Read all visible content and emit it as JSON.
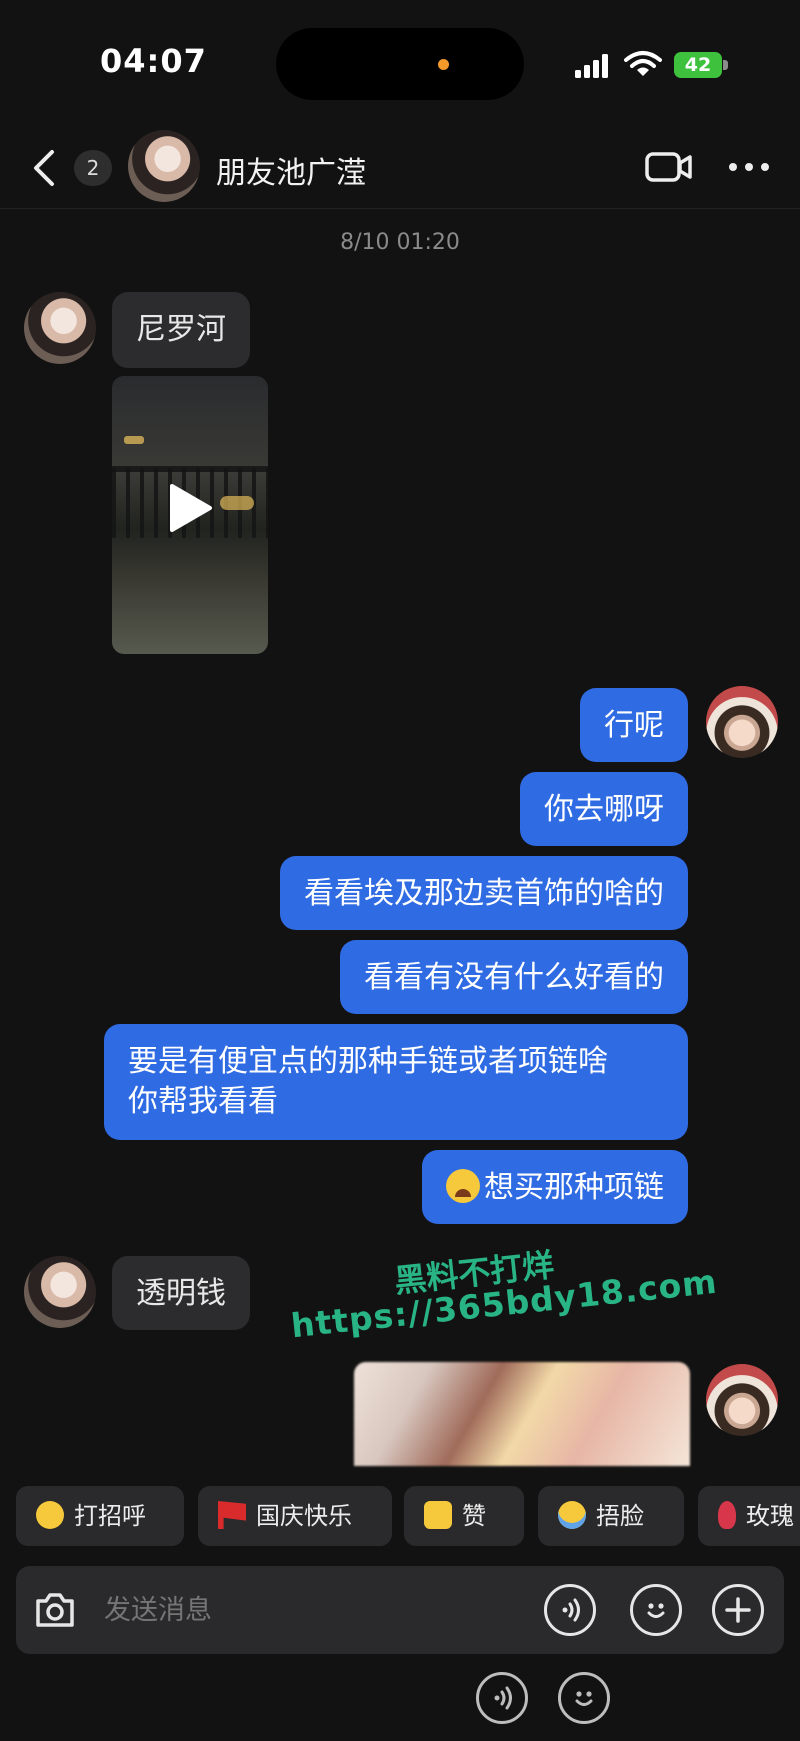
{
  "status_bar": {
    "time": "04:07",
    "battery": "42"
  },
  "header": {
    "unread_count": "2",
    "title": "朋友池广滢"
  },
  "timestamp": "8/10 01:20",
  "messages": {
    "m1": "尼罗河",
    "m2": "行呢",
    "m3": "你去哪呀",
    "m4": "看看埃及那边卖首饰的啥的",
    "m5": "看看有没有什么好看的",
    "m6_line1": "要是有便宜点的那种手链或者项链啥",
    "m6_line2": "你帮我看看",
    "m7": "想买那种项链",
    "m8": "透明钱"
  },
  "watermark": {
    "line1": "黑料不打烊",
    "line2": "https://365bdy18.com"
  },
  "quick_replies": [
    "打招呼",
    "国庆快乐",
    "赞",
    "捂脸",
    "玫瑰"
  ],
  "input": {
    "placeholder": "发送消息"
  },
  "colors": {
    "background": "#121212",
    "bubble_out": "#2f6be3",
    "bubble_in": "#2c2c2e",
    "watermark": "#2ed19a"
  }
}
